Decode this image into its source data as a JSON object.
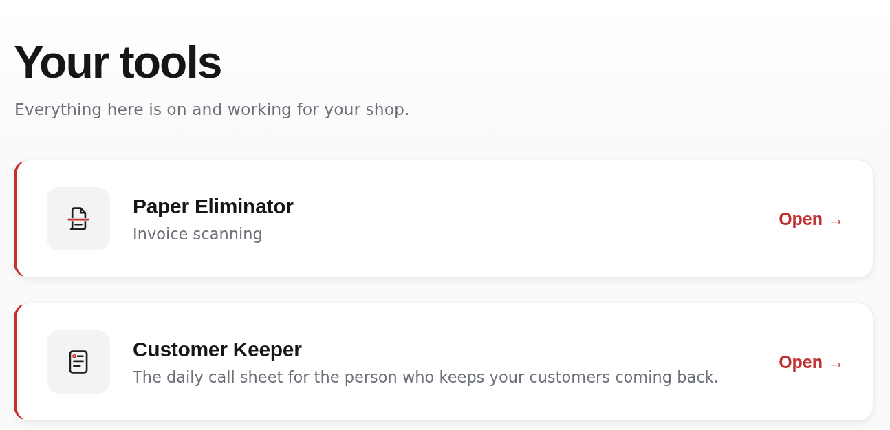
{
  "header": {
    "title": "Your tools",
    "subtitle": "Everything here is on and working for your shop."
  },
  "tools": [
    {
      "name": "Paper Eliminator",
      "description": "Invoice scanning",
      "action": "Open →"
    },
    {
      "name": "Customer Keeper",
      "description": "The daily call sheet for the person who keeps your customers coming back.",
      "action": "Open →"
    }
  ]
}
